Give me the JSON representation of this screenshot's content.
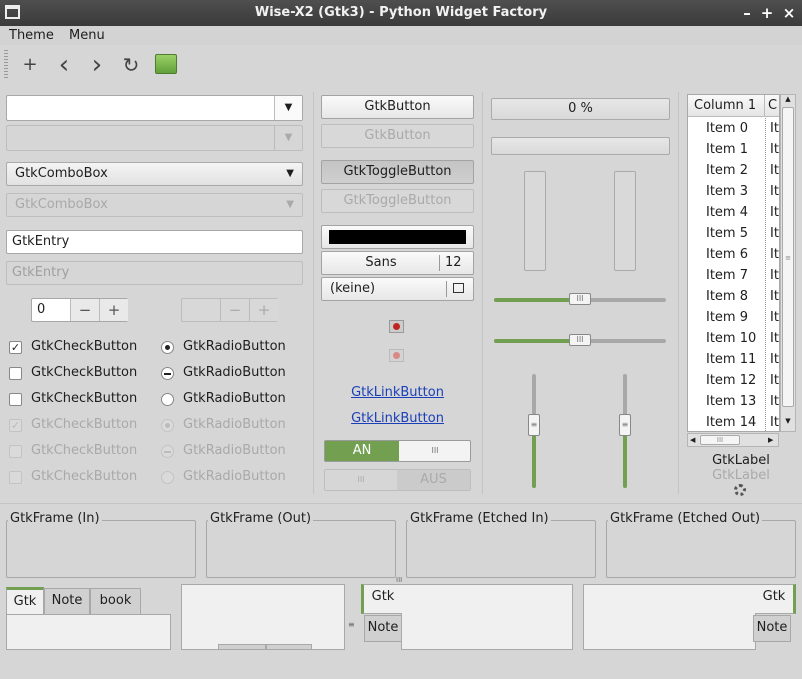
{
  "window": {
    "title": "Wise-X2 (Gtk3) - Python Widget Factory",
    "minimize": "–",
    "maximize": "+",
    "close": "×"
  },
  "menu": {
    "items": [
      "Theme",
      "Menu"
    ]
  },
  "toolbar": {
    "add": "+",
    "back": "‹",
    "forward": "›",
    "refresh": "↻"
  },
  "col1": {
    "combo_entry_value": "",
    "combo_entry_disabled": "",
    "combo": "GtkComboBox",
    "combo_disabled": "GtkComboBox",
    "entry": "GtkEntry",
    "entry_disabled": "GtkEntry",
    "spin_value": "0",
    "spin_disabled_value": "",
    "spin_minus": "−",
    "spin_plus": "+",
    "checks": [
      {
        "label": "GtkCheckButton",
        "state": "checked"
      },
      {
        "label": "GtkCheckButton",
        "state": "unchecked"
      },
      {
        "label": "GtkCheckButton",
        "state": "unchecked"
      },
      {
        "label": "GtkCheckButton",
        "state": "checked-disabled"
      },
      {
        "label": "GtkCheckButton",
        "state": "unchecked-disabled"
      },
      {
        "label": "GtkCheckButton",
        "state": "unchecked-disabled"
      }
    ],
    "radios": [
      {
        "label": "GtkRadioButton",
        "state": "selected"
      },
      {
        "label": "GtkRadioButton",
        "state": "inconsistent"
      },
      {
        "label": "GtkRadioButton",
        "state": "unselected"
      },
      {
        "label": "GtkRadioButton",
        "state": "selected-disabled"
      },
      {
        "label": "GtkRadioButton",
        "state": "inconsistent-disabled"
      },
      {
        "label": "GtkRadioButton",
        "state": "unselected-disabled"
      }
    ]
  },
  "col2": {
    "button": "GtkButton",
    "button_disabled": "GtkButton",
    "toggle": "GtkToggleButton",
    "toggle_disabled": "GtkToggleButton",
    "font_name": "Sans",
    "font_size": "12",
    "file_chooser": "(keine)",
    "link1": "GtkLinkButton",
    "link2": "GtkLinkButton",
    "switch_on": "AN",
    "switch_off": "AUS",
    "switch_grip": "III"
  },
  "col3": {
    "progress_text": "0 %",
    "progress_value": 0,
    "hscale1_value": 0.5,
    "hscale2_value": 0.5,
    "vscale1_value": 0.55,
    "vscale2_value": 0.55
  },
  "tree": {
    "columns": [
      "Column 1",
      "C"
    ],
    "rows": [
      "Item 0",
      "Item 1",
      "Item 2",
      "Item 3",
      "Item 4",
      "Item 5",
      "Item 6",
      "Item 7",
      "Item 8",
      "Item 9",
      "Item 10",
      "Item 11",
      "Item 12",
      "Item 13",
      "Item 14"
    ],
    "col2_cell": "It",
    "hscroll_grip": "III",
    "label": "GtkLabel",
    "label_disabled": "GtkLabel"
  },
  "frames": [
    "GtkFrame (In)",
    "GtkFrame (Out)",
    "GtkFrame (Etched In)",
    "GtkFrame (Etched Out)"
  ],
  "notebook1": {
    "tabs": [
      "Gtk",
      "Note",
      "book"
    ]
  },
  "notebook3": {
    "tabs": [
      "Gtk",
      "Note"
    ]
  },
  "notebook4": {
    "tabs": [
      "Gtk",
      "Note"
    ]
  },
  "colors": {
    "accent": "#72a050",
    "link": "#1a3fb8",
    "titlebar": "#3a3a3a"
  }
}
